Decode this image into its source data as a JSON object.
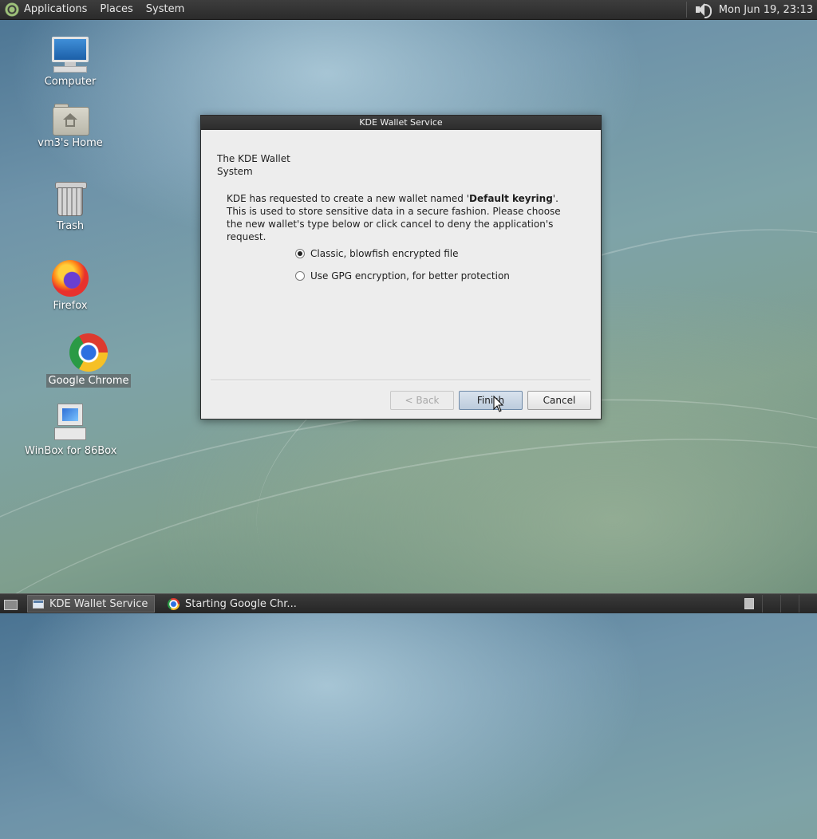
{
  "top_panel": {
    "menus": [
      "Applications",
      "Places",
      "System"
    ],
    "clock": "Mon Jun 19, 23:13"
  },
  "desktop_icons": {
    "computer": "Computer",
    "home": "vm3's Home",
    "trash": "Trash",
    "firefox": "Firefox",
    "chrome": "Google Chrome",
    "winbox": "WinBox for 86Box"
  },
  "dialog": {
    "title": "KDE Wallet Service",
    "heading_line1": "The KDE Wallet",
    "heading_line2": "System",
    "message_before": "KDE has requested to create a new wallet named '",
    "message_bold": "Default keyring",
    "message_after": "'. This is used to store sensitive data in a secure fashion. Please choose the new wallet's type below or click cancel to deny the application's request.",
    "options": [
      {
        "label": "Classic, blowfish encrypted file",
        "checked": true
      },
      {
        "label": "Use GPG encryption, for better protection",
        "checked": false
      }
    ],
    "buttons": {
      "back": "< Back",
      "finish": "Finish",
      "cancel": "Cancel"
    }
  },
  "taskbar": {
    "tasks": [
      {
        "label": "KDE Wallet Service",
        "active": true
      },
      {
        "label": "Starting Google Chr...",
        "active": false
      }
    ]
  }
}
